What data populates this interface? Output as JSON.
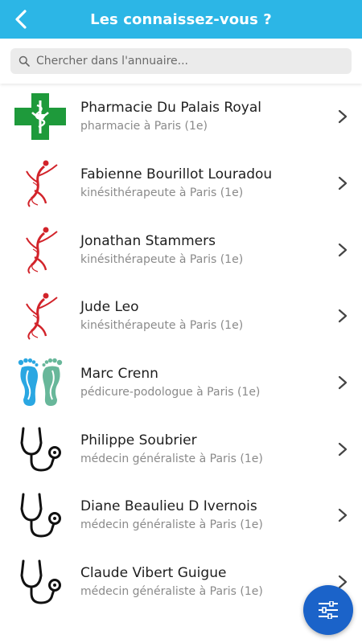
{
  "header": {
    "title": "Les connaissez-vous ?",
    "back_icon": "chevron-left-icon",
    "color": "#2cb6e6"
  },
  "search": {
    "placeholder": "Chercher dans l'annuaire..."
  },
  "list": {
    "items": [
      {
        "name": "Pharmacie Du Palais Royal",
        "subtitle": "pharmacie à Paris (1e)",
        "icon": "pharmacy-cross-icon"
      },
      {
        "name": "Fabienne Bourillot Louradou",
        "subtitle": "kinésithérapeute à Paris (1e)",
        "icon": "physio-figure-icon"
      },
      {
        "name": "Jonathan Stammers",
        "subtitle": "kinésithérapeute à Paris (1e)",
        "icon": "physio-figure-icon"
      },
      {
        "name": "Jude Leo",
        "subtitle": "kinésithérapeute à Paris (1e)",
        "icon": "physio-figure-icon"
      },
      {
        "name": "Marc Crenn",
        "subtitle": "pédicure-podologue à Paris (1e)",
        "icon": "feet-icon"
      },
      {
        "name": "Philippe Soubrier",
        "subtitle": "médecin généraliste à Paris (1e)",
        "icon": "stethoscope-icon"
      },
      {
        "name": "Diane Beaulieu D Ivernois",
        "subtitle": "médecin généraliste à Paris (1e)",
        "icon": "stethoscope-icon"
      },
      {
        "name": "Claude Vibert Guigue",
        "subtitle": "médecin généraliste à Paris (1e)",
        "icon": "stethoscope-icon"
      }
    ]
  },
  "fab": {
    "icon": "filter-sliders-icon",
    "color": "#1b63c9"
  }
}
